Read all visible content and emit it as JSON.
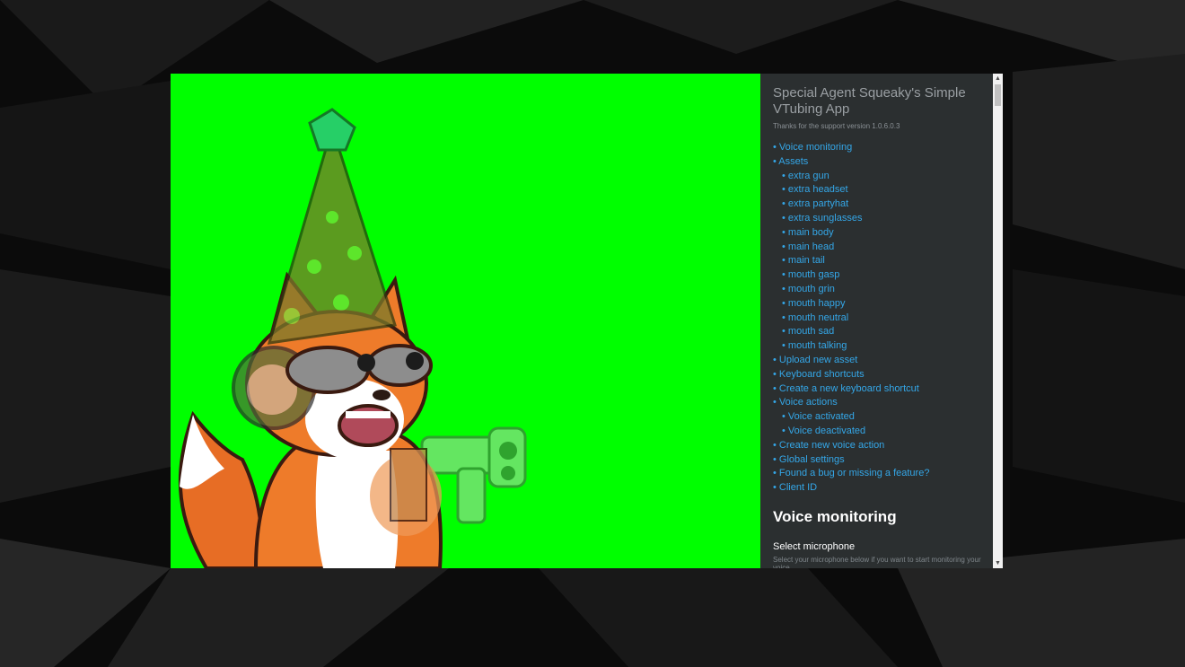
{
  "colors": {
    "stage_background": "#00ff00",
    "panel_background": "#2b2f30",
    "link": "#34a7e8",
    "title": "#9a9fa3"
  },
  "panel": {
    "title": "Special Agent Squeaky's Simple VTubing App",
    "subtitle": "Thanks for the support version 1.0.6.0.3",
    "nav": [
      {
        "label": "• Voice monitoring",
        "level": 0
      },
      {
        "label": "• Assets",
        "level": 0
      },
      {
        "label": "• extra gun",
        "level": 1
      },
      {
        "label": "• extra headset",
        "level": 1
      },
      {
        "label": "• extra partyhat",
        "level": 1
      },
      {
        "label": "• extra sunglasses",
        "level": 1
      },
      {
        "label": "• main body",
        "level": 1
      },
      {
        "label": "• main head",
        "level": 1
      },
      {
        "label": "• main tail",
        "level": 1
      },
      {
        "label": "• mouth gasp",
        "level": 1
      },
      {
        "label": "• mouth grin",
        "level": 1
      },
      {
        "label": "• mouth happy",
        "level": 1
      },
      {
        "label": "• mouth neutral",
        "level": 1
      },
      {
        "label": "• mouth sad",
        "level": 1
      },
      {
        "label": "• mouth talking",
        "level": 1
      },
      {
        "label": "• Upload new asset",
        "level": 0
      },
      {
        "label": "• Keyboard shortcuts",
        "level": 0
      },
      {
        "label": "• Create a new keyboard shortcut",
        "level": 0
      },
      {
        "label": "• Voice actions",
        "level": 0
      },
      {
        "label": "• Voice activated",
        "level": 1
      },
      {
        "label": "• Voice deactivated",
        "level": 1
      },
      {
        "label": "• Create new voice action",
        "level": 0
      },
      {
        "label": "• Global settings",
        "level": 0
      },
      {
        "label": "• Found a bug or missing a feature?",
        "level": 0
      },
      {
        "label": "• Client ID",
        "level": 0
      }
    ],
    "section_title": "Voice monitoring",
    "field_label": "Select microphone",
    "field_help": "Select your microphone below if you want to start monitoring your voice"
  },
  "scrollbar": {
    "up_icon": "triangle-up-icon",
    "down_icon": "triangle-down-icon"
  },
  "avatar": {
    "layers": [
      "main tail",
      "main body",
      "main head",
      "extra partyhat",
      "extra headset",
      "extra sunglasses",
      "mouth talking",
      "extra gun"
    ]
  }
}
